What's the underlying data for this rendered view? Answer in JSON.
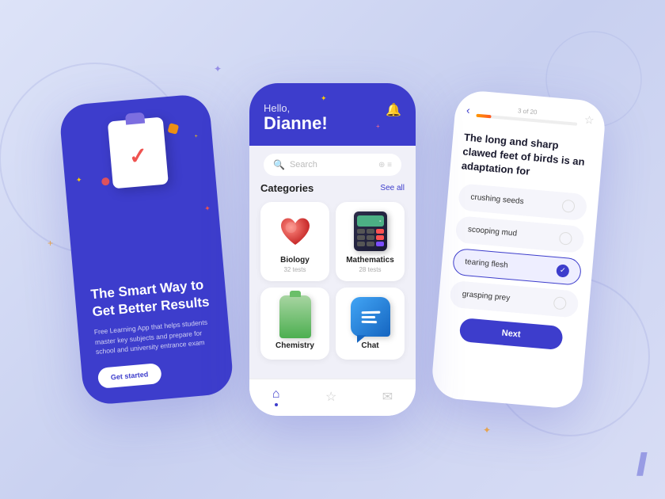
{
  "background": {
    "color1": "#dde3f8",
    "color2": "#c8d0f0"
  },
  "phone_left": {
    "title": "The Smart Way to Get Better Results",
    "description": "Free Learning App that helps students master key subjects and prepare for school and university entrance exam",
    "cta_button": "Get started",
    "bg_color": "#3d3dcc"
  },
  "phone_center": {
    "greeting": "Hello,",
    "name": "Dianne!",
    "search_placeholder": "Search",
    "categories_title": "Categories",
    "see_all_label": "See all",
    "categories": [
      {
        "name": "Biology",
        "count": "32 tests"
      },
      {
        "name": "Mathematics",
        "count": "28 tests"
      },
      {
        "name": "Chemistry",
        "count": ""
      },
      {
        "name": "Chat",
        "count": ""
      }
    ],
    "nav_items": [
      "home",
      "bookmark",
      "mail"
    ]
  },
  "phone_right": {
    "progress_label": "3 of 20",
    "progress_percent": 15,
    "question": "The long and sharp clawed feet of birds is an adaptation for",
    "options": [
      {
        "text": "crushing seeds",
        "correct": false
      },
      {
        "text": "scooping mud",
        "correct": false
      },
      {
        "text": "tearing flesh",
        "correct": true
      },
      {
        "text": "grasping prey",
        "correct": false
      }
    ],
    "next_button": "Next"
  },
  "double_slash": "//"
}
